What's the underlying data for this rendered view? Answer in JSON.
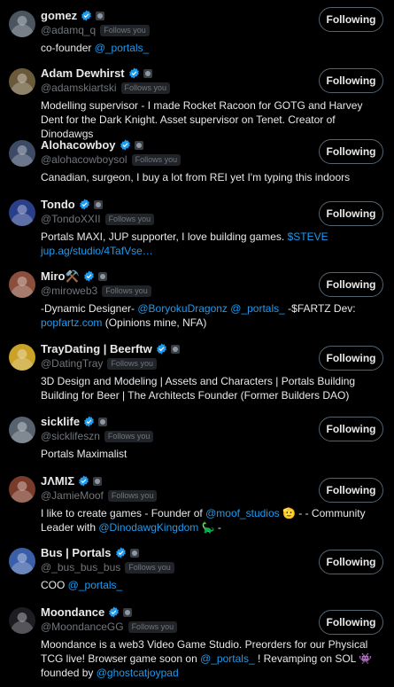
{
  "follow_label": "Following",
  "follows_you_label": "Follows you",
  "users": [
    {
      "name": "gomez",
      "handle": "@adamq_q",
      "verified": true,
      "follows_you": true,
      "avatar": "#4a5560",
      "bio": [
        {
          "t": "co-founder "
        },
        {
          "t": "@_portals_",
          "link": true
        }
      ]
    },
    {
      "name": "Adam Dewhirst",
      "handle": "@adamskiartski",
      "verified": true,
      "follows_you": true,
      "avatar": "#6b5a3a",
      "bio": [
        {
          "t": "Modelling supervisor - I made Rocket Racoon for GOTG and Harvey Dent for the Dark Knight. Asset supervisor on Tenet. Creator of Dinodawgs"
        }
      ]
    },
    {
      "name": "Alohacowboy",
      "handle": "@alohacowboysol",
      "verified": true,
      "follows_you": true,
      "avatar": "#3c4a66",
      "bio": [
        {
          "t": "Canadian, surgeon, I buy a lot from REI yet I'm typing this indoors"
        }
      ]
    },
    {
      "name": "Tondo",
      "handle": "@TondoXXII",
      "verified": true,
      "follows_you": true,
      "avatar": "#2a3f8a",
      "bio": [
        {
          "t": "Portals MAXI, JUP supporter, I love building games. "
        },
        {
          "t": "$STEVE",
          "link": true
        },
        {
          "t": " "
        },
        {
          "t": "jup.ag/studio/4TafVse…",
          "link": true
        }
      ]
    },
    {
      "name": "Miro⚒️",
      "handle": "@miroweb3",
      "verified": true,
      "follows_you": true,
      "avatar": "#8a4f3c",
      "bio": [
        {
          "t": "-Dynamic Designer- "
        },
        {
          "t": "@BoryokuDragonz",
          "link": true
        },
        {
          "t": " "
        },
        {
          "t": "@_portals_",
          "link": true
        },
        {
          "t": " -$FARTZ Dev: "
        },
        {
          "t": "popfartz.com",
          "link": true
        },
        {
          "t": " (Opinions mine, NFA)"
        }
      ]
    },
    {
      "name": "TrayDating | Beerftw",
      "handle": "@DatingTray",
      "verified": true,
      "follows_you": true,
      "avatar": "#c9a227",
      "bio": [
        {
          "t": "3D Design and Modeling | Assets and Characters | Portals Building Building for Beer | The Architects Founder (Former Builders DAO)"
        }
      ]
    },
    {
      "name": "sicklife",
      "handle": "@sicklifeszn",
      "verified": true,
      "follows_you": true,
      "avatar": "#56626d",
      "bio": [
        {
          "t": "Portals Maximalist"
        }
      ]
    },
    {
      "name": "JΛMIΣ",
      "handle": "@JamieMoof",
      "verified": true,
      "follows_you": true,
      "avatar": "#7a3b2a",
      "bio": [
        {
          "t": "I like to create games - Founder of "
        },
        {
          "t": "@moof_studios",
          "link": true
        },
        {
          "t": " 🫡 - - Community Leader with "
        },
        {
          "t": "@DinodawgKingdom",
          "link": true
        },
        {
          "t": " 🦕 -"
        }
      ]
    },
    {
      "name": "Bus | Portals",
      "handle": "@_bus_bus_bus",
      "verified": true,
      "follows_you": true,
      "avatar": "#3b5ea8",
      "bio": [
        {
          "t": "COO "
        },
        {
          "t": "@_portals_",
          "link": true
        }
      ]
    },
    {
      "name": "Moondance",
      "handle": "@MoondanceGG",
      "verified": true,
      "follows_you": true,
      "avatar": "#1c1c22",
      "bio": [
        {
          "t": "Moondance is a web3 Video Game Studio. Preorders for our Physical TCG live! Browser game soon on "
        },
        {
          "t": "@_portals_",
          "link": true
        },
        {
          "t": " ! Revamping on SOL 👾 founded by "
        },
        {
          "t": "@ghostcatjoypad",
          "link": true
        }
      ]
    }
  ]
}
